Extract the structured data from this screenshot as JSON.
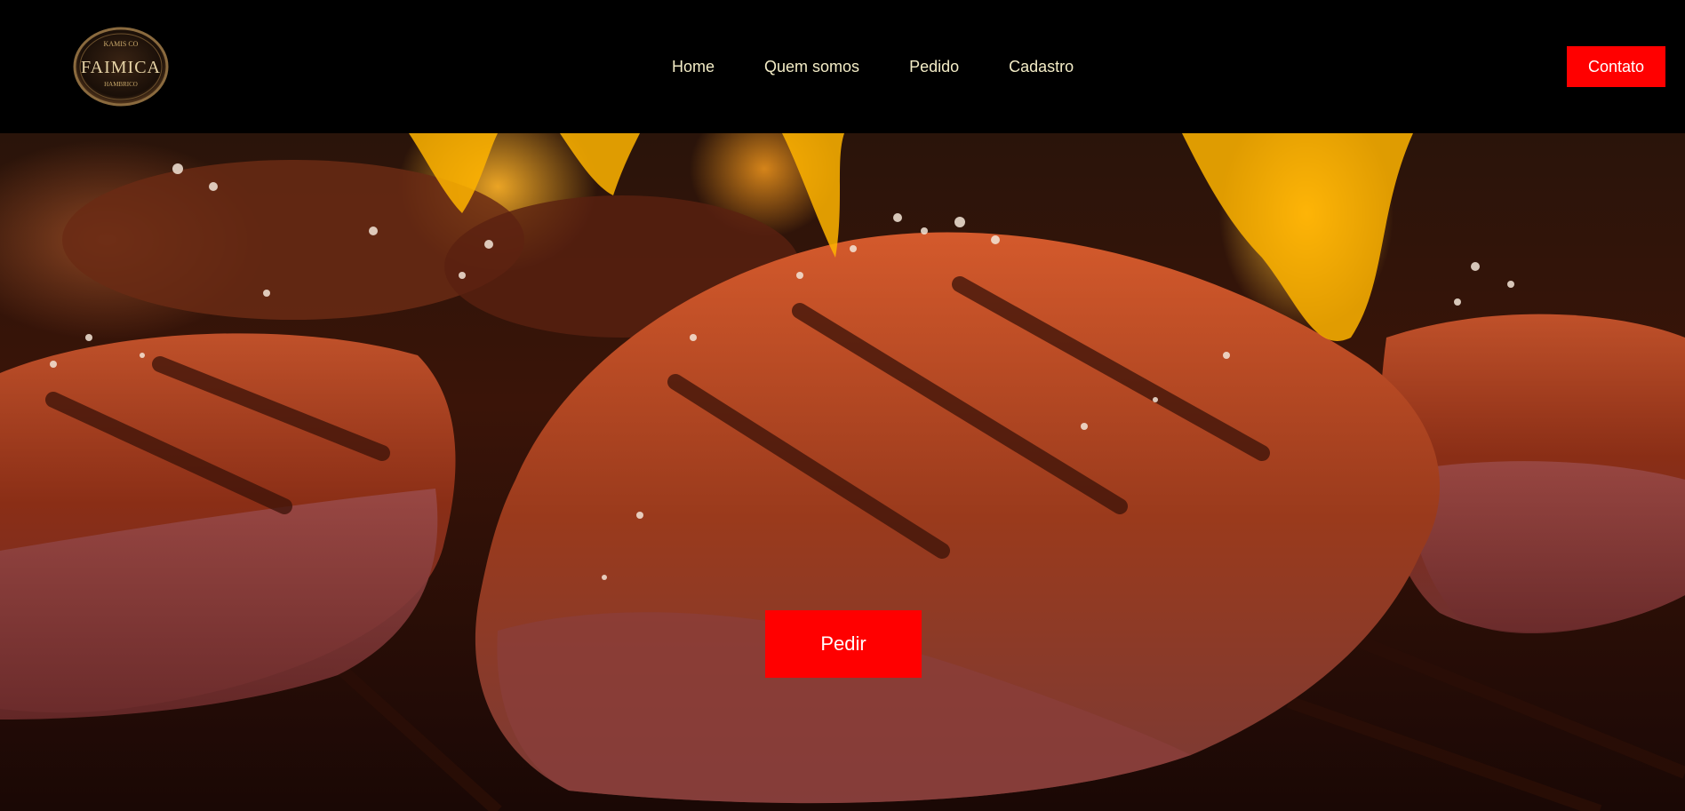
{
  "brand": {
    "logo_top": "KAMIS CO",
    "logo_main": "FAIMICA",
    "logo_bottom": "HAMBRICO"
  },
  "nav": {
    "items": [
      {
        "label": "Home"
      },
      {
        "label": "Quem somos"
      },
      {
        "label": "Pedido"
      },
      {
        "label": "Cadastro"
      }
    ],
    "contact_label": "Contato"
  },
  "hero": {
    "order_label": "Pedir"
  },
  "colors": {
    "accent": "#ff0000",
    "nav_text": "#f3ecc6",
    "header_bg": "#000000"
  }
}
